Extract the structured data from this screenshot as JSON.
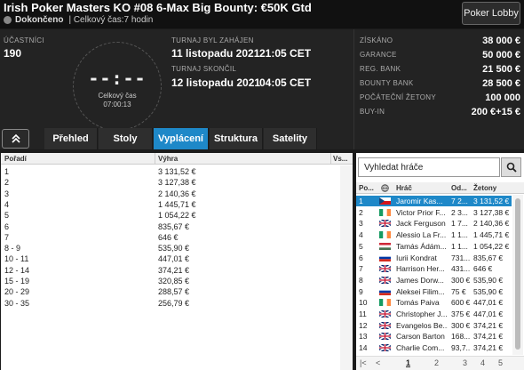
{
  "header": {
    "title": "Irish Poker Masters KO #08 6-Max Big Bounty: €50K Gtd",
    "status": "Dokončeno",
    "duration": "| Celkový čas:7 hodin",
    "lobby_button": "Poker Lobby"
  },
  "info": {
    "participants_label": "ÚČASTNÍCI",
    "participants_value": "190",
    "clock_display": "--:--",
    "clock_label": "Celkový čas",
    "clock_value": "07:00:13",
    "started_label": "TURNAJ BYL ZAHÁJEN",
    "started_date": "11 listopadu 2021",
    "started_time": "21:05 CET",
    "ended_label": "TURNAJ SKONČIL",
    "ended_date": "12 listopadu 2021",
    "ended_time": "04:05 CET",
    "right": [
      {
        "label": "ZÍSKÁNO",
        "value": "38 000 €"
      },
      {
        "label": "GARANCE",
        "value": "50 000 €"
      },
      {
        "label": "REG. BANK",
        "value": "21 500 €"
      },
      {
        "label": "BOUNTY BANK",
        "value": "28 500 €"
      },
      {
        "label": "POČÁTEČNÍ ŽETONY",
        "value": "100 000"
      },
      {
        "label": "BUY-IN",
        "value": "200 €+15 €"
      }
    ]
  },
  "tabs": [
    "Přehled",
    "Stoly",
    "Vyplácení",
    "Struktura",
    "Satelity"
  ],
  "active_tab": "Vyplácení",
  "payouts": {
    "headers": [
      "Pořadí",
      "Výhra",
      "Vs..."
    ],
    "rows": [
      {
        "place": "1",
        "prize": "3 131,52 €"
      },
      {
        "place": "2",
        "prize": "3 127,38 €"
      },
      {
        "place": "3",
        "prize": "2 140,36 €"
      },
      {
        "place": "4",
        "prize": "1 445,71 €"
      },
      {
        "place": "5",
        "prize": "1 054,22 €"
      },
      {
        "place": "6",
        "prize": "835,67 €"
      },
      {
        "place": "7",
        "prize": "646 €"
      },
      {
        "place": "8 - 9",
        "prize": "535,90 €"
      },
      {
        "place": "10 - 11",
        "prize": "447,01 €"
      },
      {
        "place": "12 - 14",
        "prize": "374,21 €"
      },
      {
        "place": "15 - 19",
        "prize": "320,85 €"
      },
      {
        "place": "20 - 29",
        "prize": "288,57 €"
      },
      {
        "place": "30 - 35",
        "prize": "256,79 €"
      }
    ]
  },
  "players": {
    "search_placeholder": "Vyhledat hráče",
    "headers": [
      "Po...",
      "Hráč",
      "Od...",
      "Žetony"
    ],
    "rows": [
      {
        "pos": "1",
        "flag": "cz",
        "name": "Jaromir Kas...",
        "od": "7 2...",
        "chips": "3 131,52 €",
        "selected": true
      },
      {
        "pos": "2",
        "flag": "ie",
        "name": "Victor Prior F...",
        "od": "2 3...",
        "chips": "3 127,38 €"
      },
      {
        "pos": "3",
        "flag": "gb",
        "name": "Jack Ferguson",
        "od": "1 7...",
        "chips": "2 140,36 €"
      },
      {
        "pos": "4",
        "flag": "ie",
        "name": "Alessio La Fr...",
        "od": "1 1...",
        "chips": "1 445,71 €"
      },
      {
        "pos": "5",
        "flag": "hu",
        "name": "Tamás Ádám...",
        "od": "1 1...",
        "chips": "1 054,22 €"
      },
      {
        "pos": "6",
        "flag": "ru",
        "name": "Iurii Kondrat",
        "od": "731...",
        "chips": "835,67 €"
      },
      {
        "pos": "7",
        "flag": "gb",
        "name": "Harrison Her...",
        "od": "431...",
        "chips": "646 €"
      },
      {
        "pos": "8",
        "flag": "gb",
        "name": "James Dorw...",
        "od": "300 €",
        "chips": "535,90 €"
      },
      {
        "pos": "9",
        "flag": "ru",
        "name": "Aleksei Filim...",
        "od": "75 €",
        "chips": "535,90 €"
      },
      {
        "pos": "10",
        "flag": "ie",
        "name": "Tomás Paiva",
        "od": "600 €",
        "chips": "447,01 €"
      },
      {
        "pos": "11",
        "flag": "gb",
        "name": "Christopher J...",
        "od": "375 €",
        "chips": "447,01 €"
      },
      {
        "pos": "12",
        "flag": "gb",
        "name": "Evangelos Be...",
        "od": "300 €",
        "chips": "374,21 €"
      },
      {
        "pos": "13",
        "flag": "gb",
        "name": "Carson Barton",
        "od": "168...",
        "chips": "374,21 €"
      },
      {
        "pos": "14",
        "flag": "gb",
        "name": "Charlie Com...",
        "od": "93,7...",
        "chips": "374,21 €"
      }
    ],
    "pages": [
      "1",
      "2",
      "3",
      "4",
      "5"
    ],
    "current_page": "1"
  },
  "colors": {
    "accent": "#1e88c8",
    "background": "#1b1b1b",
    "panel": "#232323"
  },
  "icons": {
    "status": "circle-icon",
    "collapse": "chevrons-up-icon",
    "search": "magnifier-icon"
  }
}
